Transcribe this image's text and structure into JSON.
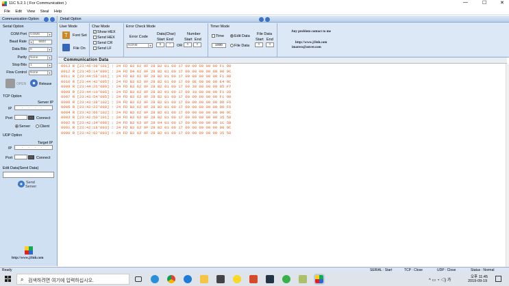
{
  "window": {
    "title": "11C 5.2.1 ( For Communication )"
  },
  "menu": [
    "File",
    "Edit",
    "View",
    "Steal",
    "Help"
  ],
  "left": {
    "panel_title": "Communication Option",
    "serial_title": "Serial Option",
    "com_port_label": "COM Port",
    "com_port_value": "COM5",
    "baud_label": "Baud Rate",
    "baud_value": "9600",
    "data_bits_label": "Data Bits",
    "data_bits_value": "8",
    "parity_label": "Parity",
    "parity_value": "None",
    "stop_bits_label": "Stop Bits",
    "stop_bits_value": "1",
    "flow_label": "Flow Control",
    "flow_value": "None",
    "open_label": "OPEN",
    "release_label": "Release",
    "tcp_title": "TCP Option",
    "server_ip_label": "Server IP",
    "ip_label": "IP",
    "port_label": "Port",
    "connect_label": "Connect",
    "server_label": "Server",
    "client_label": "Client",
    "udp_title": "UDP Option",
    "target_ip_label": "Target IP",
    "udp_ip_label": "IP",
    "udp_port_label": "Port",
    "udp_connect_label": "Connect",
    "edit_title": "Edit Data(Send Data)",
    "send_label": "Send",
    "server_label2": "Server",
    "url": "http://www.j1lnh.com"
  },
  "detail": {
    "panel_title": "Detail Option",
    "user_mode": "User Mode",
    "font_set": "Font Set",
    "file_on": "File  On",
    "char_mode": "Char Mode",
    "show_hex": "Show HEX",
    "send_hex": "Send HEX",
    "send_cr": "Send CR",
    "send_lf": "Send LF",
    "error_check": "Error Check Mode",
    "error_code": "Error Code",
    "data_char": "Data(Char)",
    "number": "Number",
    "start": "Start",
    "end": "End",
    "or_label": "OR",
    "error_code_value": "NONE",
    "dc_start": "$",
    "dc_end": "*",
    "num_start": "0",
    "num_end": "0",
    "timer_mode": "Timer Mode",
    "time_label": "Time",
    "edit_data": "Edit Data",
    "timer_value": "1000",
    "file_data": "File Data",
    "file_data2": "File Data",
    "fd_start": "Start",
    "fd_end": "End",
    "fd_start_val": "0",
    "fd_end_val": "0",
    "contact": "Any problem contact to me",
    "contact_url": "http://www.j1lnh.com",
    "contact_email": "imaress@anver.com"
  },
  "comm": {
    "title": "Communication Data",
    "lines": [
      "0013 R [23:45:38'101] : 24 FD B3 62 9F 28 B2 01 00 17 00 00 00 00 00 F1 00",
      "0012 R [23:45:14'099] : 24 FD D4 62 9F 28 B2 01 00 17 00 00 00 00 00 00 9C",
      "0011 R [23:44:58'101] : 24 FD B3 62 9F 28 B2 01 00 17 00 00 00 00 00 F1 00",
      "0010 R [23:44:42'095] : 24 FD B3 62 9F 28 B2 01 00 17 00 0E 00 00 00 E4 0C",
      "0009 R [23:44:26'099] : 24 FD B3 62 9F 28 B2 01 00 17 00 38 00 00 00 05 F7",
      "0008 R [23:44:10'096] : 24 FD B3 62 9F 28 B2 01 00 17 00 10 00 00 00 F1 2D",
      "0007 R [23:43:54'095] : 24 FD B3 62 9F 28 B2 01 00 17 00 00 00 00 00 F1 00",
      "0006 R [23:43:38'102] : 24 FD B3 62 9F 28 B2 01 00 17 00 00 00 00 00 DD F6",
      "0005 R [23:43:22'099] : 24 FD B3 62 9F 28 B2 01 00 17 00 00 00 00 00 DD F6",
      "0004 R [23:43:06'102] : 24 FD B3 62 9F 28 B2 01 00 17 00 00 00 00 00 00 9C",
      "0003 R [23:42:50'101] : 24 FD B3 62 9F 28 B2 01 00 17 00 00 00 00 00 35 50",
      "0002 R [23:42:34'098] : 24 FD B3 62 9F 28 04 01 00 17 00 00 00 00 00 1C 5B",
      "0001 R [23:42:18'093] : 24 FD B3 62 9F 28 B2 01 00 17 00 00 00 00 00 00 9C",
      "0000 R [23:42:02'093] : 24 FD B3 62 9F 28 B2 01 00 17 00 00 00 00 00 35 50"
    ]
  },
  "status": {
    "ready": "Ready",
    "serial": "SERIAL : Start",
    "tcp": "TCP : Close",
    "udp": "UDP : Close",
    "state": "Status : Normal"
  },
  "taskbar": {
    "search_placeholder": "검색하려면 여기에 입력하십시오.",
    "time": "오후 11:45",
    "date": "2019-09-19"
  }
}
